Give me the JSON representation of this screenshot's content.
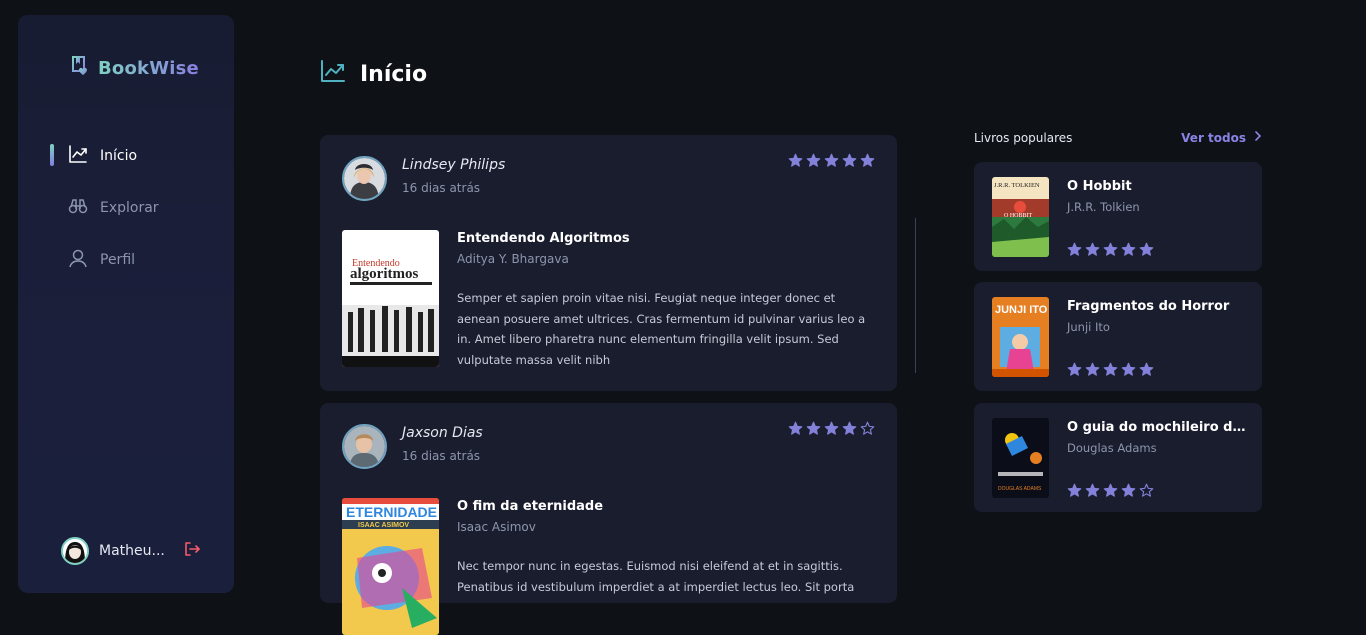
{
  "sidebar": {
    "logo_text": "BookWise",
    "nav": [
      {
        "label": "Início",
        "icon": "chart-line-icon",
        "active": true
      },
      {
        "label": "Explorar",
        "icon": "binoculars-icon",
        "active": false
      },
      {
        "label": "Perfil",
        "icon": "user-icon",
        "active": false
      }
    ],
    "user_name": "Matheu..."
  },
  "main": {
    "title": "Início"
  },
  "reviews": [
    {
      "user": "Lindsey Philips",
      "time": "16 dias atrás",
      "rating": 5,
      "book_title": "Entendendo Algoritmos",
      "book_author": "Aditya Y. Bhargava",
      "cover_top_text": "Entendendo",
      "cover_main_text": "algoritmos",
      "description": "Semper et sapien proin vitae nisi. Feugiat neque integer donec et aenean posuere amet ultrices. Cras fermentum id pulvinar varius leo a in. Amet libero pharetra nunc elementum fringilla velit ipsum. Sed vulputate massa velit nibh"
    },
    {
      "user": "Jaxson Dias",
      "time": "16 dias atrás",
      "rating": 4,
      "book_title": "O fim da eternidade",
      "book_author": "Isaac Asimov",
      "cover_top_text": "ETERNIDADE",
      "cover_main_text": "ISAAC ASIMOV",
      "description": "Nec tempor nunc in egestas. Euismod nisi eleifend at et in sagittis. Penatibus id vestibulum imperdiet a at imperdiet lectus leo. Sit porta"
    }
  ],
  "popular": {
    "label": "Livros populares",
    "see_all": "Ver todos",
    "books": [
      {
        "title": "O Hobbit",
        "author": "J.R.R. Tolkien",
        "rating": 5,
        "cover_text": "J.R.R. TOLKIEN"
      },
      {
        "title": "Fragmentos do Horror",
        "author": "Junji Ito",
        "rating": 5,
        "cover_text": "JUNJI ITO"
      },
      {
        "title": "O guia do mochileiro das ...",
        "author": "Douglas Adams",
        "rating": 4,
        "cover_text": "DOUGLAS ADAMS"
      }
    ]
  },
  "colors": {
    "accent": "#8381d9",
    "star": "#8381d9",
    "logout": "#f75a68"
  }
}
